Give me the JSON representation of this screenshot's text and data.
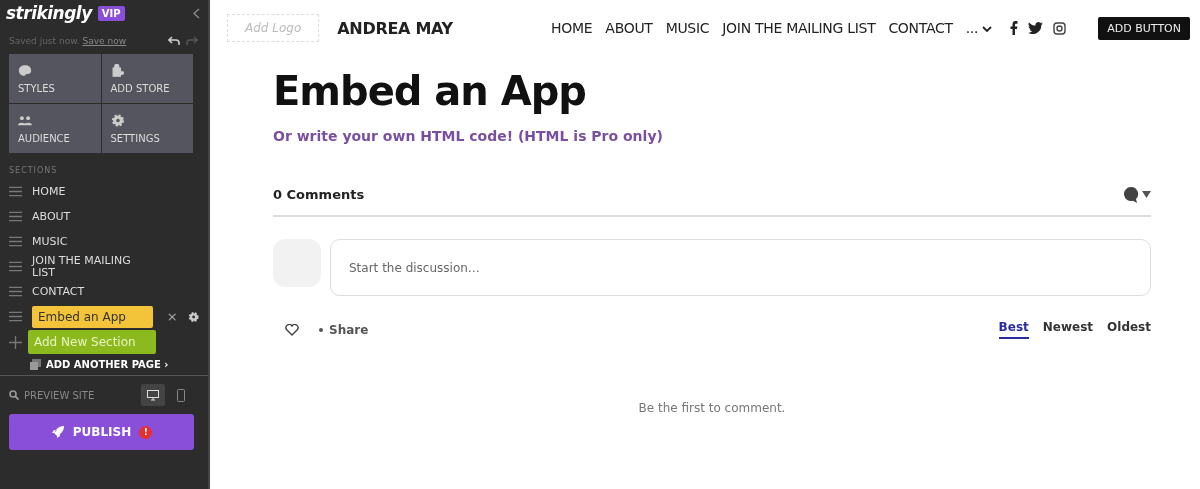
{
  "sidebar": {
    "logo": "strikingly",
    "badge": "VIP",
    "save_status": "Saved just now.",
    "save_link": "Save now",
    "tools": [
      {
        "kind": "styles",
        "label": "STYLES"
      },
      {
        "kind": "store",
        "label": "ADD STORE"
      },
      {
        "kind": "audience",
        "label": "AUDIENCE"
      },
      {
        "kind": "settings",
        "label": "SETTINGS"
      }
    ],
    "sections_heading": "SECTIONS",
    "sections": [
      {
        "label": "HOME",
        "selected": false
      },
      {
        "label": "ABOUT",
        "selected": false
      },
      {
        "label": "MUSIC",
        "selected": false
      },
      {
        "label": "JOIN THE MAILING LIST",
        "selected": false
      },
      {
        "label": "CONTACT",
        "selected": false
      },
      {
        "label": "Embed an App",
        "selected": true
      }
    ],
    "remove_icon": "×",
    "add_section": "Add New Section",
    "add_page": "ADD ANOTHER PAGE",
    "add_page_arrow": "›",
    "preview": "PREVIEW SITE",
    "publish": "PUBLISH",
    "publish_alert": "!"
  },
  "site": {
    "logo_placeholder": "Add Logo",
    "name": "ANDREA MAY",
    "nav": [
      "HOME",
      "ABOUT",
      "MUSIC",
      "JOIN THE MAILING LIST",
      "CONTACT"
    ],
    "more": "...",
    "cta": "ADD BUTTON",
    "title": "Embed an App",
    "subtitle": "Or write your own HTML code! (HTML is Pro only)"
  },
  "comments": {
    "count": "0 Comments",
    "placeholder": "Start the discussion…",
    "share": "Share",
    "sorts": [
      {
        "label": "Best",
        "selected": true
      },
      {
        "label": "Newest",
        "selected": false
      },
      {
        "label": "Oldest",
        "selected": false
      }
    ],
    "empty": "Be the first to comment."
  }
}
